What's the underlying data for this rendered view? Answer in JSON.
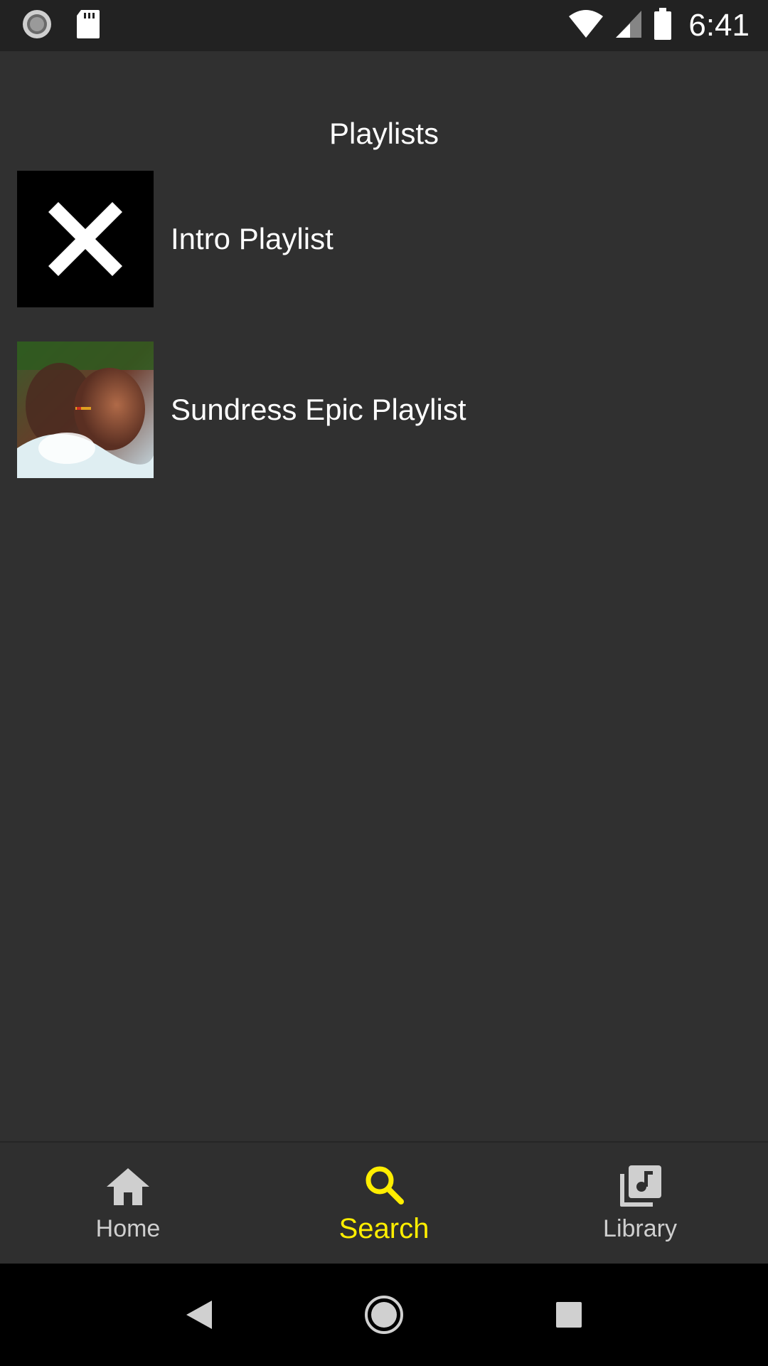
{
  "status_bar": {
    "time": "6:41",
    "left_icons": [
      "sync-icon",
      "sd-card-icon"
    ],
    "right_icons": [
      "wifi-icon",
      "signal-icon",
      "battery-icon"
    ]
  },
  "page": {
    "title": "Playlists"
  },
  "playlists": [
    {
      "name": "Intro Playlist",
      "cover": "x-logo-cover"
    },
    {
      "name": "Sundress Epic Playlist",
      "cover": "photo-cover"
    }
  ],
  "bottom_nav": {
    "items": [
      {
        "label": "Home",
        "icon": "home-icon",
        "active": false
      },
      {
        "label": "Search",
        "icon": "search-icon",
        "active": true
      },
      {
        "label": "Library",
        "icon": "library-music-icon",
        "active": false
      }
    ]
  },
  "colors": {
    "background": "#303030",
    "status_bar": "#222222",
    "accent": "#ffee00",
    "nav_inactive": "#cfcfcf",
    "system_nav": "#000000"
  },
  "system_nav": {
    "buttons": [
      "back-icon",
      "home-circle-icon",
      "recents-icon"
    ]
  }
}
